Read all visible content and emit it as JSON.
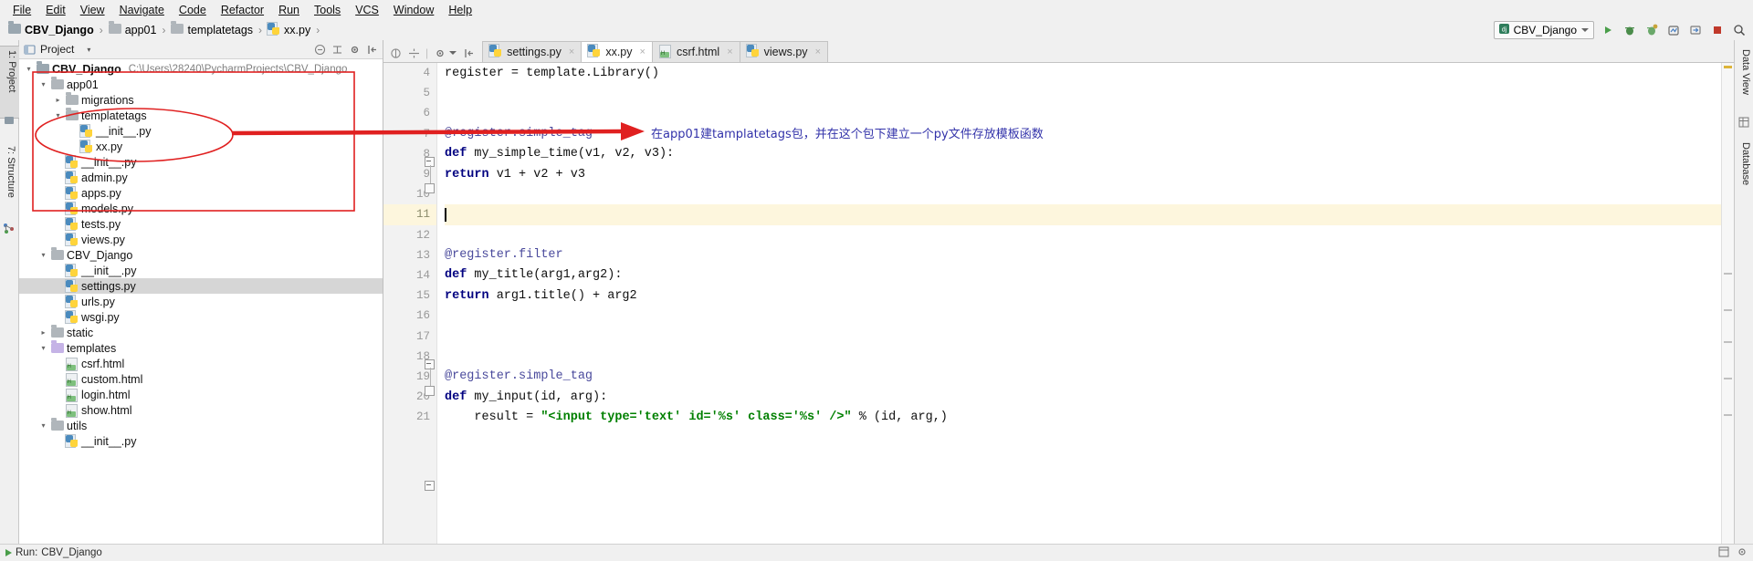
{
  "menu": {
    "items": [
      "File",
      "Edit",
      "View",
      "Navigate",
      "Code",
      "Refactor",
      "Run",
      "Tools",
      "VCS",
      "Window",
      "Help"
    ]
  },
  "breadcrumb": {
    "items": [
      {
        "label": "CBV_Django",
        "icon": "project-folder-icon"
      },
      {
        "label": "app01",
        "icon": "folder-icon"
      },
      {
        "label": "templatetags",
        "icon": "folder-icon"
      },
      {
        "label": "xx.py",
        "icon": "python-file-icon"
      }
    ],
    "separator": "›"
  },
  "toolbar": {
    "run_config": "CBV_Django",
    "icons": [
      "run-icon",
      "debug-icon",
      "coverage-icon",
      "profile-icon",
      "attach-icon",
      "stop-icon",
      "search-everywhere-icon"
    ]
  },
  "left_strip": {
    "tabs": [
      "1: Project",
      "7: Structure"
    ],
    "extra_icons": [
      "favorites-icon",
      "structure-icon"
    ]
  },
  "right_strip": {
    "tabs": [
      "Data View",
      "Database"
    ]
  },
  "project_panel": {
    "title": "Project",
    "header_icons": [
      "project-view-icon",
      "collapse-all-icon",
      "expand-icon",
      "settings-gear-icon",
      "hide-panel-icon"
    ],
    "tree": [
      {
        "label": "CBV_Django",
        "path": "C:\\Users\\28240\\PycharmProjects\\CBV_Django",
        "indent": 1,
        "twisty": "down",
        "icon": "project-folder-icon",
        "bold": true,
        "selected": false
      },
      {
        "label": "app01",
        "path": "",
        "indent": 2,
        "twisty": "down",
        "icon": "folder-icon",
        "bold": false,
        "selected": false
      },
      {
        "label": "migrations",
        "path": "",
        "indent": 3,
        "twisty": "right",
        "icon": "folder-icon",
        "bold": false,
        "selected": false
      },
      {
        "label": "templatetags",
        "path": "",
        "indent": 3,
        "twisty": "down",
        "icon": "folder-icon",
        "bold": false,
        "selected": false
      },
      {
        "label": "__init__.py",
        "path": "",
        "indent": 4,
        "twisty": "",
        "icon": "python-file-icon",
        "bold": false,
        "selected": false
      },
      {
        "label": "xx.py",
        "path": "",
        "indent": 4,
        "twisty": "",
        "icon": "python-file-icon",
        "bold": false,
        "selected": false
      },
      {
        "label": "__init__.py",
        "path": "",
        "indent": 3,
        "twisty": "",
        "icon": "python-file-icon",
        "bold": false,
        "selected": false
      },
      {
        "label": "admin.py",
        "path": "",
        "indent": 3,
        "twisty": "",
        "icon": "python-file-icon",
        "bold": false,
        "selected": false
      },
      {
        "label": "apps.py",
        "path": "",
        "indent": 3,
        "twisty": "",
        "icon": "python-file-icon",
        "bold": false,
        "selected": false
      },
      {
        "label": "models.py",
        "path": "",
        "indent": 3,
        "twisty": "",
        "icon": "python-file-icon",
        "bold": false,
        "selected": false
      },
      {
        "label": "tests.py",
        "path": "",
        "indent": 3,
        "twisty": "",
        "icon": "python-file-icon",
        "bold": false,
        "selected": false
      },
      {
        "label": "views.py",
        "path": "",
        "indent": 3,
        "twisty": "",
        "icon": "python-file-icon",
        "bold": false,
        "selected": false
      },
      {
        "label": "CBV_Django",
        "path": "",
        "indent": 2,
        "twisty": "down",
        "icon": "folder-icon",
        "bold": false,
        "selected": false
      },
      {
        "label": "__init__.py",
        "path": "",
        "indent": 3,
        "twisty": "",
        "icon": "python-file-icon",
        "bold": false,
        "selected": false
      },
      {
        "label": "settings.py",
        "path": "",
        "indent": 3,
        "twisty": "",
        "icon": "python-file-icon",
        "bold": false,
        "selected": true
      },
      {
        "label": "urls.py",
        "path": "",
        "indent": 3,
        "twisty": "",
        "icon": "python-file-icon",
        "bold": false,
        "selected": false
      },
      {
        "label": "wsgi.py",
        "path": "",
        "indent": 3,
        "twisty": "",
        "icon": "python-file-icon",
        "bold": false,
        "selected": false
      },
      {
        "label": "static",
        "path": "",
        "indent": 2,
        "twisty": "right",
        "icon": "folder-icon",
        "bold": false,
        "selected": false
      },
      {
        "label": "templates",
        "path": "",
        "indent": 2,
        "twisty": "down",
        "icon": "templates-folder-icon",
        "bold": false,
        "selected": false
      },
      {
        "label": "csrf.html",
        "path": "",
        "indent": 3,
        "twisty": "",
        "icon": "html-file-icon",
        "bold": false,
        "selected": false
      },
      {
        "label": "custom.html",
        "path": "",
        "indent": 3,
        "twisty": "",
        "icon": "html-file-icon",
        "bold": false,
        "selected": false
      },
      {
        "label": "login.html",
        "path": "",
        "indent": 3,
        "twisty": "",
        "icon": "html-file-icon",
        "bold": false,
        "selected": false
      },
      {
        "label": "show.html",
        "path": "",
        "indent": 3,
        "twisty": "",
        "icon": "html-file-icon",
        "bold": false,
        "selected": false
      },
      {
        "label": "utils",
        "path": "",
        "indent": 2,
        "twisty": "down",
        "icon": "folder-icon",
        "bold": false,
        "selected": false
      },
      {
        "label": "__init__.py",
        "path": "",
        "indent": 3,
        "twisty": "",
        "icon": "python-file-icon",
        "bold": false,
        "selected": false
      }
    ]
  },
  "editor": {
    "tabs": [
      {
        "label": "settings.py",
        "icon": "python-file-icon",
        "active": false,
        "close": "×"
      },
      {
        "label": "xx.py",
        "icon": "python-file-icon",
        "active": true,
        "close": "×"
      },
      {
        "label": "csrf.html",
        "icon": "html-file-icon",
        "active": false,
        "close": "×"
      },
      {
        "label": "views.py",
        "icon": "python-file-icon",
        "active": false,
        "close": "×"
      }
    ],
    "current_line": 11,
    "lines": [
      {
        "num": 4,
        "html": "register = template.Library()"
      },
      {
        "num": 5,
        "html": ""
      },
      {
        "num": 6,
        "html": ""
      },
      {
        "num": 7,
        "html": "<span class=\"dec\">@register.simple_tag</span>"
      },
      {
        "num": 8,
        "html": "<span class=\"kw\">def</span> my_simple_time(v1, v2, v3):"
      },
      {
        "num": 9,
        "html": "    <span class=\"kw\">return</span> v1 + v2 + v3"
      },
      {
        "num": 10,
        "html": ""
      },
      {
        "num": 11,
        "html": "<span class=\"caret-bar\"></span>"
      },
      {
        "num": 12,
        "html": ""
      },
      {
        "num": 13,
        "html": "<span class=\"dec\">@register.filter</span>"
      },
      {
        "num": 14,
        "html": "<span class=\"kw\">def</span> my_title(arg1,arg2):"
      },
      {
        "num": 15,
        "html": "    <span class=\"kw\">return</span> arg1.title() + arg2"
      },
      {
        "num": 16,
        "html": ""
      },
      {
        "num": 17,
        "html": ""
      },
      {
        "num": 18,
        "html": ""
      },
      {
        "num": 19,
        "html": "<span class=\"dec\">@register.simple_tag</span>"
      },
      {
        "num": 20,
        "html": "<span class=\"kw\">def</span> my_input(id, arg):"
      },
      {
        "num": 21,
        "html": "    result = <span class=\"str\">\"&lt;input type='text' id='%s' class='%s' /&gt;\"</span> % (id, arg,)"
      }
    ]
  },
  "annotation": {
    "text": "在app01建tamplatetags包，并在这个包下建立一个py文件存放模板函数",
    "color": "#3333aa",
    "shape_color": "#e02020"
  },
  "statusbar": {
    "run_label": "Run:",
    "run_config": "CBV_Django"
  }
}
